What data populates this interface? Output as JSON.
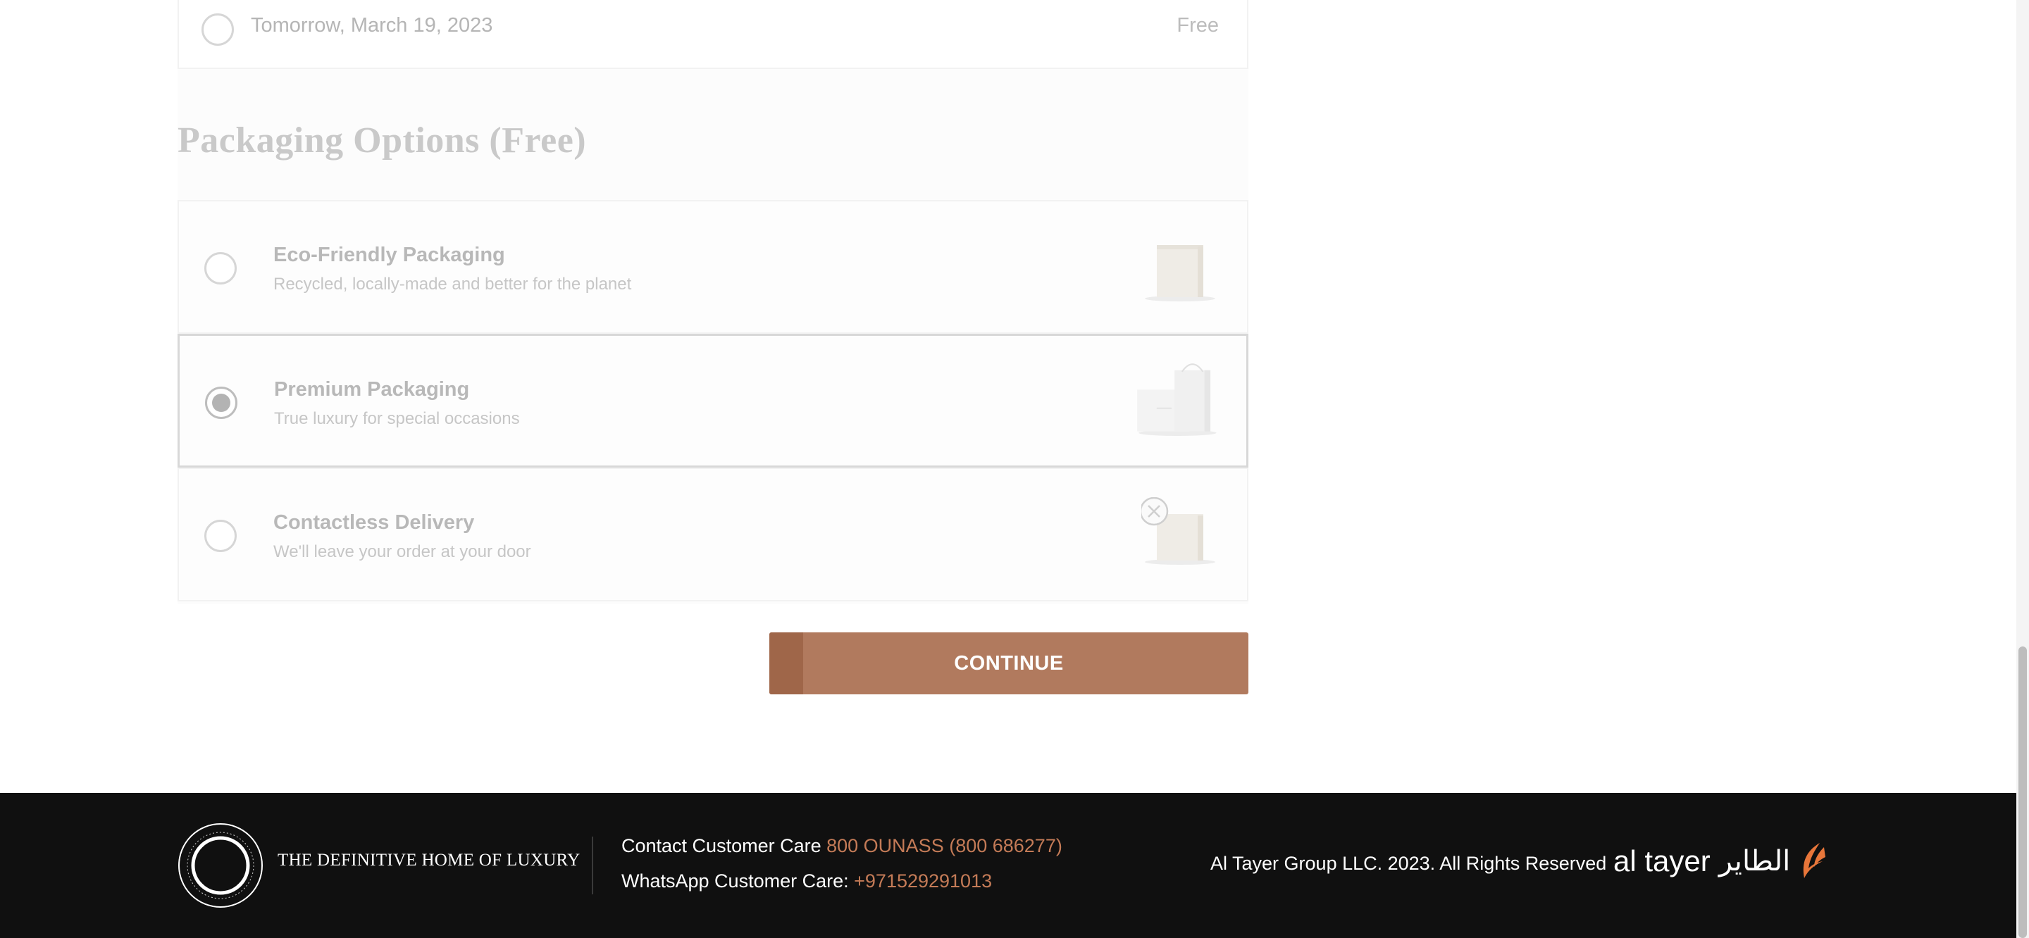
{
  "delivery": {
    "date": "Tomorrow, March 19, 2023",
    "price": "Free"
  },
  "packaging": {
    "title": "Packaging Options (Free)",
    "options": [
      {
        "title": "Eco-Friendly Packaging",
        "subtitle": "Recycled, locally-made and better for the planet",
        "selected": false,
        "icon": "eco-box-icon"
      },
      {
        "title": "Premium Packaging",
        "subtitle": "True luxury for special occasions",
        "selected": true,
        "icon": "premium-bag-icon"
      },
      {
        "title": "Contactless Delivery",
        "subtitle": "We'll leave your order at your door",
        "selected": false,
        "icon": "contactless-box-icon"
      }
    ]
  },
  "continue_button": {
    "label": "CONTINUE",
    "color": "#b17a5e"
  },
  "footer": {
    "tagline": "THE DEFINITIVE HOME OF LUXURY",
    "contact_label": "Contact Customer Care",
    "contact_number": "800 OUNASS (800 686277)",
    "whatsapp_label": "WhatsApp Customer Care:",
    "whatsapp_number": "+971529291013",
    "copyright": "Al Tayer Group LLC. 2023. All Rights Reserved",
    "logo_en": "al tayer",
    "logo_ar": "الطاير",
    "accent_color": "#c47b57"
  }
}
